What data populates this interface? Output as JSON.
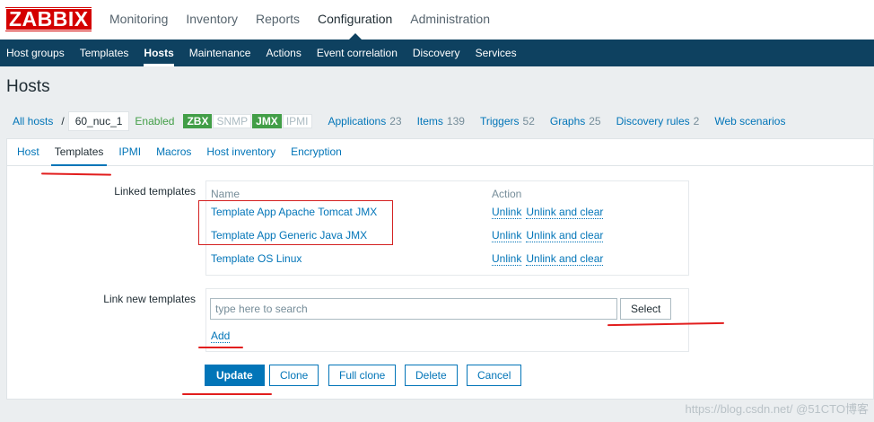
{
  "logo": "ZABBIX",
  "top_menu": [
    "Monitoring",
    "Inventory",
    "Reports",
    "Configuration",
    "Administration"
  ],
  "top_menu_active": "Configuration",
  "sub_menu": [
    "Host groups",
    "Templates",
    "Hosts",
    "Maintenance",
    "Actions",
    "Event correlation",
    "Discovery",
    "Services"
  ],
  "sub_menu_active": "Hosts",
  "page_title": "Hosts",
  "breadcrumb": {
    "all_hosts": "All hosts",
    "separator": "/",
    "host": "60_nuc_1",
    "status": "Enabled",
    "badges": [
      {
        "label": "ZBX",
        "on": true
      },
      {
        "label": "SNMP",
        "on": false
      },
      {
        "label": "JMX",
        "on": true
      },
      {
        "label": "IPMI",
        "on": false
      }
    ],
    "stats": [
      {
        "label": "Applications",
        "count": "23"
      },
      {
        "label": "Items",
        "count": "139"
      },
      {
        "label": "Triggers",
        "count": "52"
      },
      {
        "label": "Graphs",
        "count": "25"
      },
      {
        "label": "Discovery rules",
        "count": "2"
      },
      {
        "label": "Web scenarios",
        "count": ""
      }
    ]
  },
  "tabs": [
    "Host",
    "Templates",
    "IPMI",
    "Macros",
    "Host inventory",
    "Encryption"
  ],
  "tab_active": "Templates",
  "linked_templates": {
    "label": "Linked templates",
    "col_name": "Name",
    "col_action": "Action",
    "rows": [
      {
        "name": "Template App Apache Tomcat JMX",
        "unlink": "Unlink",
        "unlink_clear": "Unlink and clear"
      },
      {
        "name": "Template App Generic Java JMX",
        "unlink": "Unlink",
        "unlink_clear": "Unlink and clear"
      },
      {
        "name": "Template OS Linux",
        "unlink": "Unlink",
        "unlink_clear": "Unlink and clear"
      }
    ]
  },
  "link_new": {
    "label": "Link new templates",
    "placeholder": "type here to search",
    "select": "Select",
    "add": "Add"
  },
  "buttons": {
    "update": "Update",
    "clone": "Clone",
    "full_clone": "Full clone",
    "delete": "Delete",
    "cancel": "Cancel"
  },
  "watermark": "https://blog.csdn.net/ @51CTO博客",
  "colors": {
    "brand_red": "#d40000",
    "nav_dark": "#0e4160",
    "link": "#0275b8",
    "enabled_green": "#429e47",
    "annotation_red": "#e21e1e"
  }
}
